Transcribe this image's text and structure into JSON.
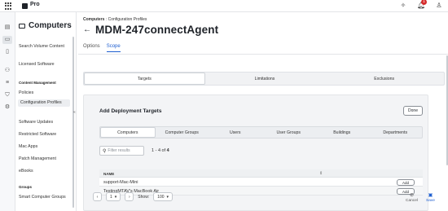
{
  "topbar": {
    "product": "Pro",
    "notification_count": "1"
  },
  "rail": {
    "icons": [
      "dashboard-icon",
      "computers-icon",
      "devices-icon",
      "users-icon",
      "settings-icon",
      "shield-icon",
      "gear-icon"
    ]
  },
  "sidebar": {
    "title": "Computers",
    "items_top": [
      "Search Volume Content",
      "Licensed Software"
    ],
    "group_content": "Content Management",
    "content_items": [
      "Policies",
      "Configuration Profiles",
      "Software Updates",
      "Restricted Software",
      "Mac Apps",
      "Patch Management",
      "eBooks"
    ],
    "group_groups": "Groups",
    "group_items": [
      "Smart Computer Groups"
    ]
  },
  "breadcrumb": {
    "root": "Computers",
    "separator": ":",
    "current": "Configuration Profiles"
  },
  "page": {
    "title": "MDM-247connectAgent"
  },
  "tabs": [
    "Options",
    "Scope"
  ],
  "scope_tabs": [
    "Targets",
    "Limitations",
    "Exclusions"
  ],
  "panel": {
    "title": "Add Deployment Targets",
    "done_label": "Done",
    "sub_tabs": [
      "Computers",
      "Computer Groups",
      "Users",
      "User Groups",
      "Buildings",
      "Departments"
    ],
    "search_placeholder": "Filter results",
    "count_prefix": "1 - 4 of",
    "count_total": "4",
    "table": {
      "header_name": "NAME",
      "rows": [
        {
          "name": "support-Mac-Mini",
          "action": "Add"
        },
        {
          "name": "TestingMTAV's MacBook Air",
          "action": "Add"
        }
      ]
    }
  },
  "pager": {
    "page": "1",
    "show_label": "Show:",
    "page_size": "100"
  },
  "actions": {
    "cancel": "Cancel",
    "save": "Save"
  }
}
